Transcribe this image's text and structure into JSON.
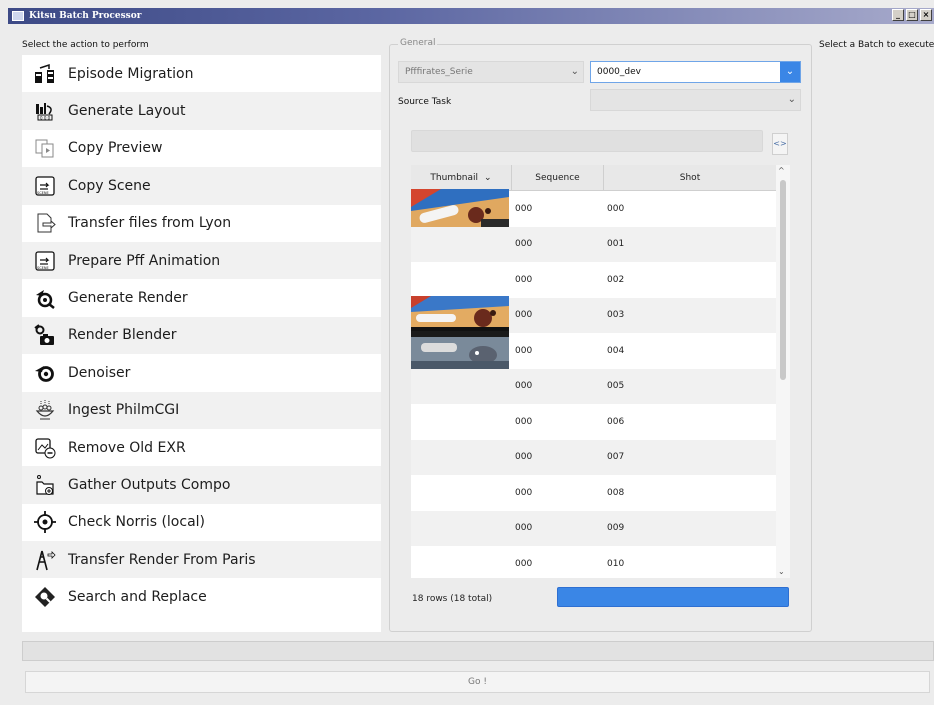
{
  "window": {
    "title": "Kitsu Batch Processor"
  },
  "labels": {
    "select_action": "Select the action to perform",
    "select_batch": "Select a Batch to execute",
    "general": "General",
    "source_task": "Source Task"
  },
  "actions": [
    {
      "label": "Episode Migration",
      "icon": "episode-migration-icon"
    },
    {
      "label": "Generate Layout",
      "icon": "generate-layout-icon"
    },
    {
      "label": "Copy Preview",
      "icon": "copy-preview-icon"
    },
    {
      "label": "Copy Scene",
      "icon": "copy-scene-icon"
    },
    {
      "label": "Transfer files from Lyon",
      "icon": "transfer-files-icon"
    },
    {
      "label": "Prepare Pff Animation",
      "icon": "prepare-animation-icon"
    },
    {
      "label": "Generate Render",
      "icon": "generate-render-icon"
    },
    {
      "label": "Render Blender",
      "icon": "render-blender-icon"
    },
    {
      "label": "Denoiser",
      "icon": "denoiser-icon"
    },
    {
      "label": "Ingest PhilmCGI",
      "icon": "ingest-icon"
    },
    {
      "label": "Remove Old EXR",
      "icon": "remove-exr-icon"
    },
    {
      "label": "Gather Outputs Compo",
      "icon": "gather-outputs-icon"
    },
    {
      "label": "Check Norris (local)",
      "icon": "check-norris-icon"
    },
    {
      "label": "Transfer Render From Paris",
      "icon": "transfer-render-icon"
    },
    {
      "label": "Search and Replace",
      "icon": "search-replace-icon"
    }
  ],
  "combos": {
    "project": "Pfffirates_Serie",
    "episode": "0000_dev",
    "source_task": ""
  },
  "toggle_label": "<>",
  "table": {
    "headers": {
      "thumbnail": "Thumbnail",
      "sequence": "Sequence",
      "shot": "Shot"
    },
    "rows": [
      {
        "sequence": "000",
        "shot": "000"
      },
      {
        "sequence": "000",
        "shot": "001"
      },
      {
        "sequence": "000",
        "shot": "002"
      },
      {
        "sequence": "000",
        "shot": "003"
      },
      {
        "sequence": "000",
        "shot": "004"
      },
      {
        "sequence": "000",
        "shot": "005"
      },
      {
        "sequence": "000",
        "shot": "006"
      },
      {
        "sequence": "000",
        "shot": "007"
      },
      {
        "sequence": "000",
        "shot": "008"
      },
      {
        "sequence": "000",
        "shot": "009"
      },
      {
        "sequence": "000",
        "shot": "010"
      }
    ]
  },
  "rows_count": "18 rows (18 total)",
  "go_label": "Go !",
  "colors": {
    "accent": "#3a86e6",
    "title_bar": "#3d4a86"
  }
}
